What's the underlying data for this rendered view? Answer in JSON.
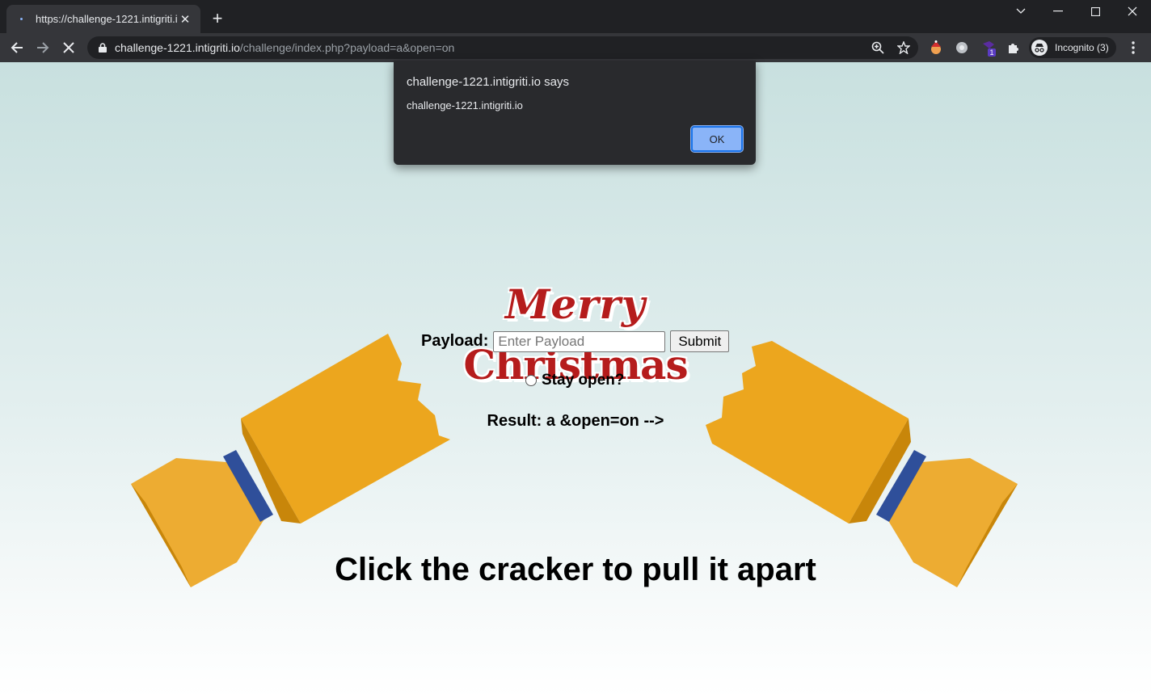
{
  "browser": {
    "tab_title": "https://challenge-1221.intigriti.io",
    "url_host": "challenge-1221.intigriti.io",
    "url_path": "/challenge/index.php?payload=a&open=on",
    "profile_label": "Incognito (3)",
    "extension_badge": "1",
    "icons": [
      "back-arrow-icon",
      "forward-arrow-icon",
      "stop-loading-icon",
      "lock-icon",
      "zoom-icon",
      "bookmark-star-icon",
      "extensions-puzzle-icon",
      "incognito-icon",
      "kebab-menu-icon"
    ]
  },
  "dialog": {
    "title": "challenge-1221.intigriti.io says",
    "message": "challenge-1221.intigriti.io",
    "ok_label": "OK",
    "accent": "#8ab4f8"
  },
  "page": {
    "logo_line1": "Merry",
    "logo_line2": "Christmas",
    "payload_label": "Payload:",
    "payload_placeholder": "Enter Payload",
    "submit_label": "Submit",
    "stay_open_label": "Stay open?",
    "result_text": "Result: a &open=on -->",
    "headline": "Click the cracker to pull it apart",
    "colors": {
      "cracker": "#eca61e",
      "cracker_shade": "#c8860a",
      "band": "#2f4f9a",
      "logo": "#b51c1c"
    }
  }
}
